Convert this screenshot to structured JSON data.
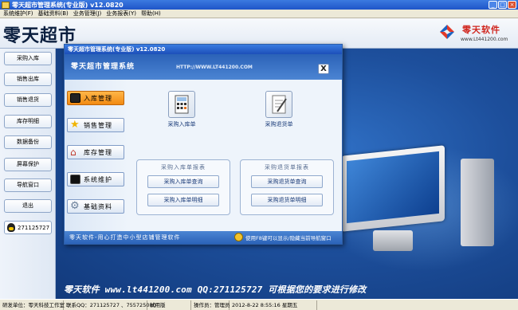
{
  "window": {
    "title": "零天超市管理系统(专业版)  v12.0820"
  },
  "menu": [
    "系统维护(F)",
    "基础资料(B)",
    "业务管理(J)",
    "业务报表(Y)",
    "帮助(H)"
  ],
  "header": {
    "brand": "零天超市",
    "logo_text": "零天软件",
    "logo_url": "www.Lt441200.com"
  },
  "sidebar": {
    "items": [
      "采购入库",
      "销售出库",
      "销售退货",
      "库存明细",
      "数据备份",
      "屏幕保护",
      "导航窗口",
      "退出"
    ],
    "qq": "271125727"
  },
  "dialog": {
    "window_title": "零天超市管理系统(专业版) v12.0820",
    "heading": "零天超市管理系统",
    "url": "HTTP://WWW.LT441200.COM",
    "close": "X",
    "nav": [
      {
        "label": "入库管理",
        "color": "#222222"
      },
      {
        "label": "销售管理",
        "color": "#f0b400"
      },
      {
        "label": "库存管理",
        "color": "#c0392b"
      },
      {
        "label": "系统维护",
        "color": "#111111"
      },
      {
        "label": "基础资料",
        "color": "#6a7f9a"
      }
    ],
    "big_buttons": [
      "采购入库单",
      "采购退货单"
    ],
    "group_in": {
      "title": "采购入库单报表",
      "buttons": [
        "采购入库单查询",
        "采购入库单明细"
      ]
    },
    "group_out": {
      "title": "采购退货单报表",
      "buttons": [
        "采购退货单查询",
        "采购退货单明细"
      ]
    },
    "footer_left": "零天软件-用心打造中小型店铺管理软件",
    "footer_right": "使用F8键可以显示/隐藏当前导航窗口"
  },
  "main": {
    "footer_text": "零天软件  www.lt441200.com  QQ:271125727  可根据您的要求进行修改"
  },
  "statusbar": {
    "cells": [
      "研发单位：零天科技工作室",
      "联系QQ：271125727 、755725080",
      "试用版",
      "操作员：管理员",
      "2012-8-22  8:55:16  星期五"
    ]
  }
}
